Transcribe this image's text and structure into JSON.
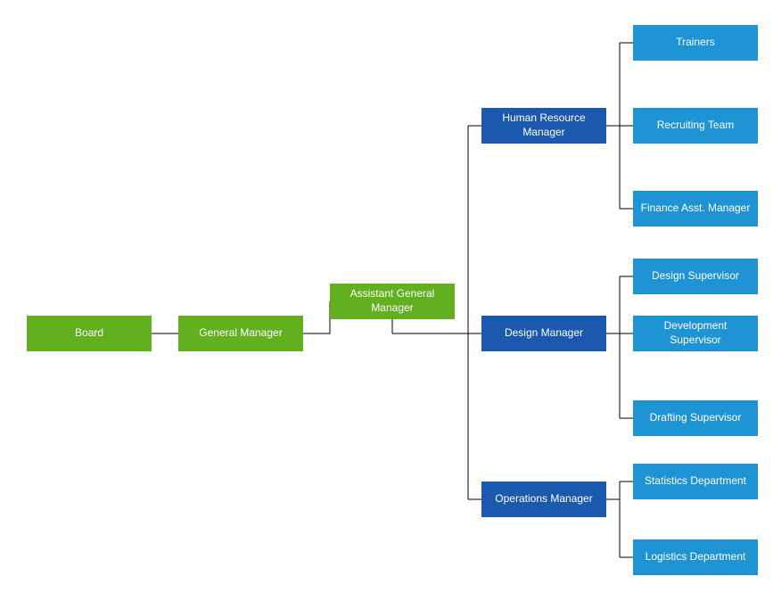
{
  "colors": {
    "green": "#62af1f",
    "darkBlue": "#1a59ad",
    "lightBlue": "#1f94d5"
  },
  "nodes": {
    "board": "Board",
    "generalManager": "General Manager",
    "assistantGeneralManager": "Assistant General Manager",
    "hrManager": "Human Resource Manager",
    "designManager": "Design Manager",
    "operationsManager": "Operations Manager",
    "trainers": "Trainers",
    "recruitingTeam": "Recruiting Team",
    "financeAsstManager": "Finance Asst. Manager",
    "designSupervisor": "Design Supervisor",
    "developmentSupervisor": "Development Supervisor",
    "draftingSupervisor": "Drafting Supervisor",
    "statisticsDepartment": "Statistics Department",
    "logisticsDepartment": "Logistics Department"
  },
  "chart_data": {
    "type": "tree",
    "title": "",
    "layout": "horizontal",
    "root": {
      "name": "Board",
      "color": "green",
      "children": [
        {
          "name": "General Manager",
          "color": "green",
          "children": [
            {
              "name": "Assistant General Manager",
              "color": "green",
              "children": [
                {
                  "name": "Human Resource Manager",
                  "color": "darkBlue",
                  "children": [
                    {
                      "name": "Trainers",
                      "color": "lightBlue"
                    },
                    {
                      "name": "Recruiting Team",
                      "color": "lightBlue"
                    },
                    {
                      "name": "Finance Asst. Manager",
                      "color": "lightBlue"
                    }
                  ]
                },
                {
                  "name": "Design Manager",
                  "color": "darkBlue",
                  "children": [
                    {
                      "name": "Design Supervisor",
                      "color": "lightBlue"
                    },
                    {
                      "name": "Development Supervisor",
                      "color": "lightBlue"
                    },
                    {
                      "name": "Drafting Supervisor",
                      "color": "lightBlue"
                    }
                  ]
                },
                {
                  "name": "Operations Manager",
                  "color": "darkBlue",
                  "children": [
                    {
                      "name": "Statistics Department",
                      "color": "lightBlue"
                    },
                    {
                      "name": "Logistics Department",
                      "color": "lightBlue"
                    }
                  ]
                }
              ]
            }
          ]
        }
      ]
    }
  }
}
